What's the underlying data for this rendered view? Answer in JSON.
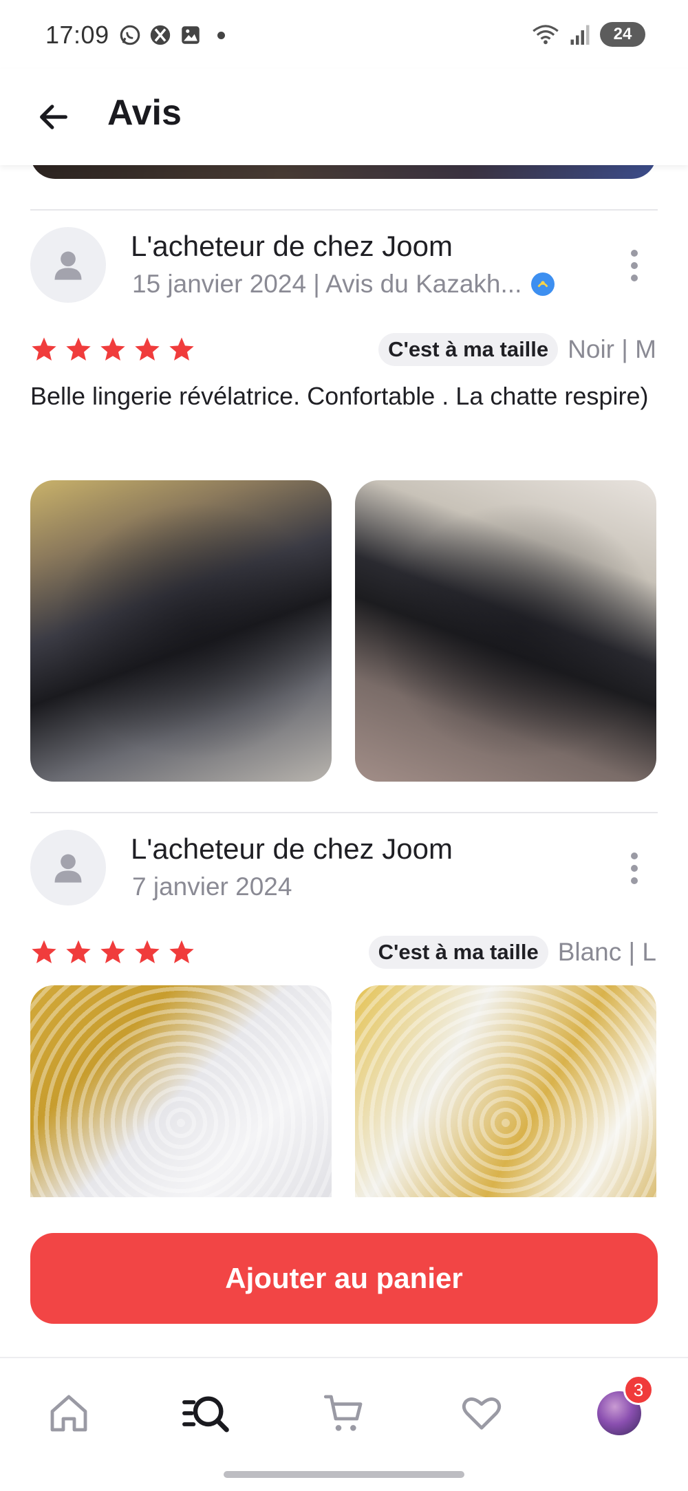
{
  "status_bar": {
    "time": "17:09",
    "left_icons": [
      "whatsapp-icon",
      "xbox-icon",
      "gallery-icon"
    ],
    "right_icons": [
      "wifi-icon",
      "signal-icon"
    ],
    "battery": "24"
  },
  "header": {
    "back_icon": "arrow-left-icon",
    "title": "Avis"
  },
  "reviews": [
    {
      "author": "L'acheteur de chez Joom",
      "date_origin": "15 janvier 2024 | Avis du Kazakh...",
      "verified_icon": "verified-badge-icon",
      "rating": 5,
      "fit": "C'est à ma taille",
      "variant": "Noir | M",
      "text": "Belle lingerie révélatrice. Confortable . La chatte respire)"
    },
    {
      "author": "L'acheteur de chez Joom",
      "date_origin": "7 janvier 2024",
      "rating": 5,
      "fit": "C'est à ma taille",
      "variant": "Blanc | L",
      "text": ""
    }
  ],
  "cta": {
    "label": "Ajouter au panier",
    "color": "#f24545"
  },
  "bottom_nav": {
    "items": [
      "home-icon",
      "search-catalog-icon",
      "cart-icon",
      "heart-icon",
      "profile-avatar"
    ],
    "active": "search-catalog-icon",
    "profile_badge": "3"
  },
  "colors": {
    "accent": "#f24545",
    "star": "#f03c3c",
    "muted_text": "#8a8a94",
    "verified": "#3d8ff0"
  }
}
